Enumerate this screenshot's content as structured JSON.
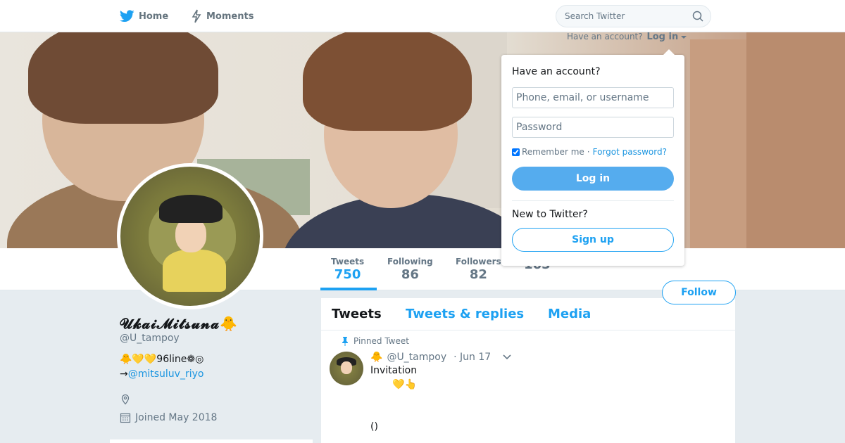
{
  "nav": {
    "home_label": "Home",
    "moments_label": "Moments",
    "search_placeholder": "Search Twitter",
    "brand_color": "#1da1f2"
  },
  "login": {
    "prompt": "Have an account?",
    "toggle_label": "Log in",
    "dropdown_title": "Have an account?",
    "username_placeholder": "Phone, email, or username",
    "password_placeholder": "Password",
    "remember_label": "Remember me",
    "separator": "·",
    "forgot_label": "Forgot password?",
    "login_button": "Log in",
    "new_prompt": "New to Twitter?",
    "signup_button": "Sign up"
  },
  "stats": [
    {
      "label": "Tweets",
      "value": "750"
    },
    {
      "label": "Following",
      "value": "86"
    },
    {
      "label": "Followers",
      "value": "82"
    },
    {
      "label": "",
      "value": "165"
    }
  ],
  "follow_button": "Follow",
  "profile": {
    "name": "𝓤𝓴𝓪𝓲𝓜𝓲𝓽𝓼𝓾𝓷𝓪🐥",
    "handle": "@U_tampoy",
    "bio_line1": "🐥💛💛96line❁◎",
    "bio_arrow": "→",
    "bio_mention": "@mitsuluv_riyo",
    "joined": "Joined May 2018"
  },
  "timeline": {
    "tabs": [
      "Tweets",
      "Tweets & replies",
      "Media"
    ],
    "pinned_label": "Pinned Tweet",
    "tweet": {
      "name": "🐥",
      "handle": "@U_tampoy",
      "date": "· Jun 17",
      "text": "Invitation\n       💛👆\n\n\n()"
    }
  }
}
